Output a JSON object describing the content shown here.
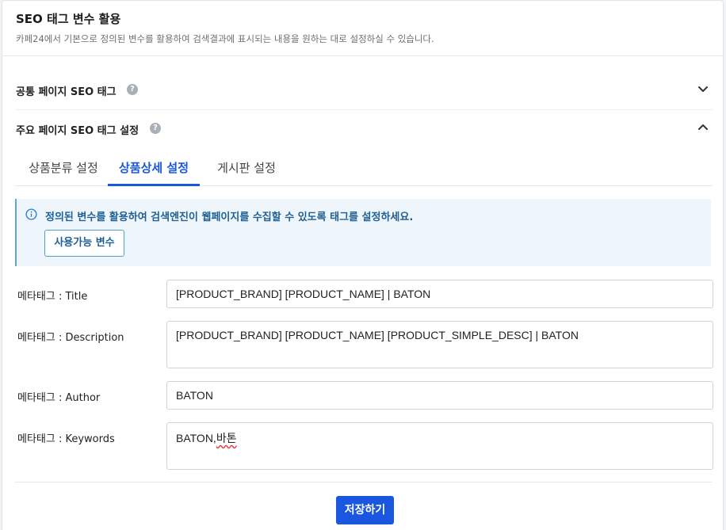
{
  "header": {
    "title": "SEO 태그 변수 활용",
    "description": "카페24에서 기본으로 정의된 변수를 활용하여 검색결과에 표시되는 내용을 원하는 대로 설정하실 수 있습니다."
  },
  "sections": [
    {
      "label": "공통 페이지 SEO 태그",
      "help_icon": "question-circle-icon",
      "state_icon": "chevron-down-icon"
    },
    {
      "label": "주요 페이지 SEO 태그 설정",
      "help_icon": "question-circle-icon",
      "state_icon": "chevron-up-icon"
    }
  ],
  "tabs": [
    {
      "label": "상품분류 설정",
      "active": false
    },
    {
      "label": "상품상세 설정",
      "active": true
    },
    {
      "label": "게시판 설정",
      "active": false
    }
  ],
  "info": {
    "icon": "info-circle-icon",
    "text": "정의된 변수를 활용하여 검색엔진이 웹페이지를 수집할 수 있도록 태그를 설정하세요.",
    "button_label": "사용가능 변수"
  },
  "fields": [
    {
      "label": "메타태그 : Title",
      "value": "[PRODUCT_BRAND] [PRODUCT_NAME] | BATON"
    },
    {
      "label": "메타태그 : Description",
      "value": "[PRODUCT_BRAND] [PRODUCT_NAME] [PRODUCT_SIMPLE_DESC] | BATON"
    },
    {
      "label": "메타태그 : Author",
      "value": "BATON"
    },
    {
      "label": "메타태그 : Keywords",
      "value_prefix": "BATON,",
      "value_spell": "바톤"
    }
  ],
  "save_label": "저장하기",
  "colors": {
    "primary": "#1b56e0",
    "info_bg": "#eef6fc",
    "info_text": "#1e5f94"
  }
}
